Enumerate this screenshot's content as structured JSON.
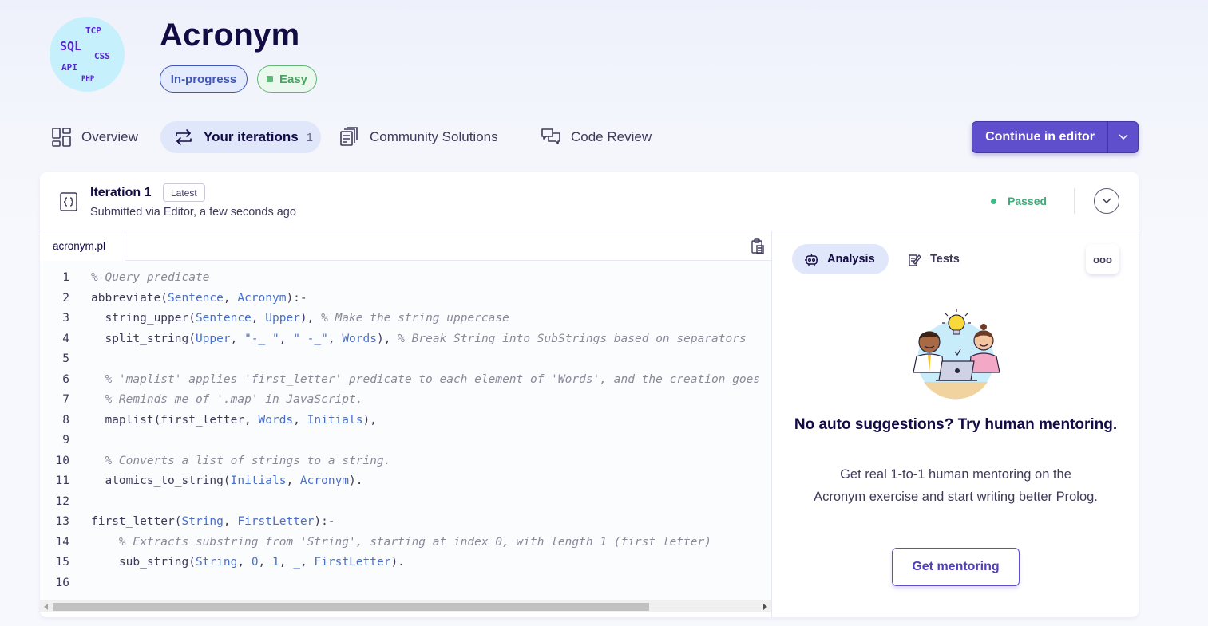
{
  "exercise": {
    "logo_words": [
      "TCP",
      "SQL",
      "CSS",
      "API",
      "PHP"
    ],
    "title": "Acronym",
    "status_tag": "In-progress",
    "difficulty_tag": "Easy"
  },
  "tabs": {
    "overview": "Overview",
    "iterations": "Your iterations",
    "iterations_count": "1",
    "community": "Community Solutions",
    "review": "Code Review"
  },
  "editor_button": {
    "label": "Continue in editor"
  },
  "iteration": {
    "title": "Iteration 1",
    "badge": "Latest",
    "subtitle": "Submitted via Editor, a few seconds ago",
    "status": "Passed"
  },
  "file": {
    "name": "acronym.pl"
  },
  "code_lines": [
    "% Query predicate",
    "abbreviate(Sentence, Acronym):-",
    "  string_upper(Sentence, Upper), % Make the string uppercase",
    "  split_string(Upper, \"-_ \", \" -_\", Words), % Break String into SubStrings based on separators",
    "",
    "  % 'maplist' applies 'first_letter' predicate to each element of 'Words', and the creation goes",
    "  % Reminds me of '.map' in JavaScript.",
    "  maplist(first_letter, Words, Initials),",
    "",
    "  % Converts a list of strings to a string.",
    "  atomics_to_string(Initials, Acronym).",
    "",
    "first_letter(String, FirstLetter):-",
    "    % Extracts substring from 'String', starting at index 0, with length 1 (first letter)",
    "    sub_string(String, 0, 1, _, FirstLetter).",
    ""
  ],
  "analysis": {
    "tab_analysis": "Analysis",
    "tab_tests": "Tests",
    "more": "ooo",
    "mentor_title": "No auto suggestions? Try human mentoring.",
    "mentor_text": "Get real 1-to-1 human mentoring on the Acronym exercise and start writing better Prolog.",
    "mentor_button": "Get mentoring"
  },
  "colors": {
    "accent": "#604fcd",
    "passed": "#43b889",
    "easy": "#5fb877",
    "in_progress": "#3f56b7"
  }
}
